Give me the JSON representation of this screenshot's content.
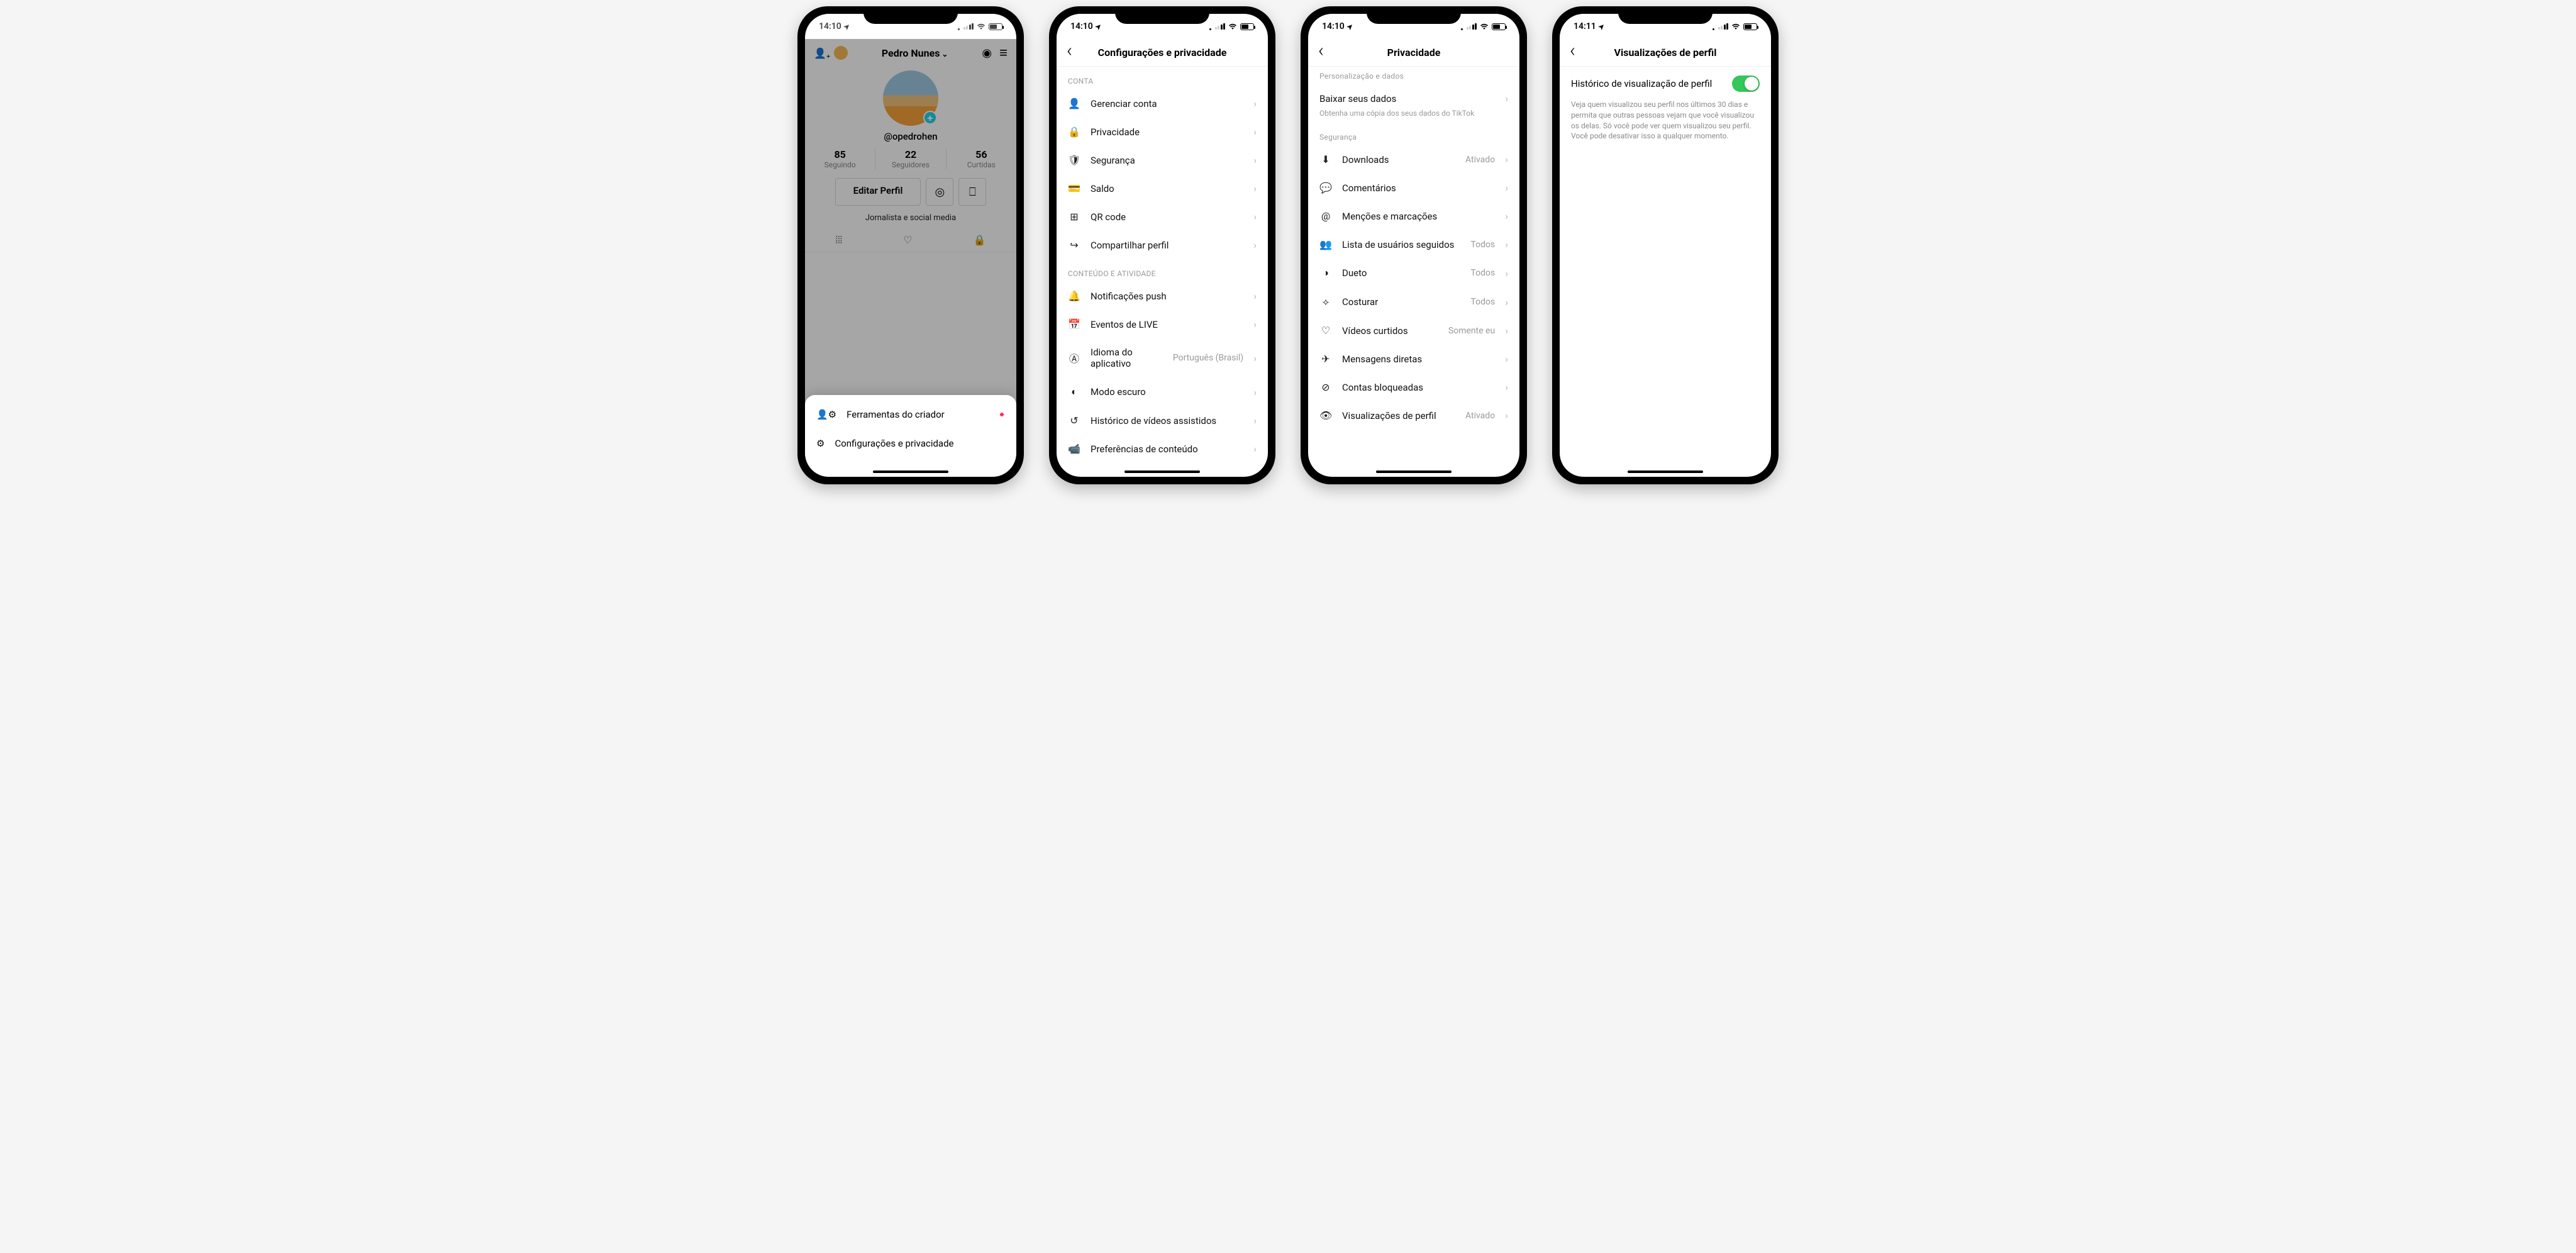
{
  "status": {
    "time1": "14:10",
    "time4": "14:11"
  },
  "screen1": {
    "name": "Pedro Nunes",
    "handle": "@opedrohen",
    "stats": [
      {
        "value": "85",
        "label": "Seguindo"
      },
      {
        "value": "22",
        "label": "Seguidores"
      },
      {
        "value": "56",
        "label": "Curtidas"
      }
    ],
    "edit_button": "Editar Perfil",
    "bio": "Jornalista e social media",
    "sheet": {
      "creator_tools": "Ferramentas do criador",
      "settings": "Configurações e privacidade"
    }
  },
  "screen2": {
    "title": "Configurações e privacidade",
    "section_conta": "CONTA",
    "items_conta": [
      {
        "icon": "👤",
        "label": "Gerenciar conta"
      },
      {
        "icon": "🔒",
        "label": "Privacidade"
      },
      {
        "icon": "🛡",
        "label": "Segurança"
      },
      {
        "icon": "💳",
        "label": "Saldo"
      },
      {
        "icon": "⊞",
        "label": "QR code"
      },
      {
        "icon": "↪",
        "label": "Compartilhar perfil"
      }
    ],
    "section_conteudo": "CONTEÚDO E ATIVIDADE",
    "items_conteudo": [
      {
        "icon": "🔔",
        "label": "Notificações push"
      },
      {
        "icon": "📅",
        "label": "Eventos de LIVE"
      },
      {
        "icon": "Ⓐ",
        "label": "Idioma do aplicativo",
        "value": "Português (Brasil)"
      },
      {
        "icon": "◐",
        "label": "Modo escuro"
      },
      {
        "icon": "↺",
        "label": "Histórico de vídeos assistidos"
      },
      {
        "icon": "📹",
        "label": "Preferências de conteúdo"
      }
    ]
  },
  "screen3": {
    "title": "Privacidade",
    "section_person": "Personalização e dados",
    "download_title": "Baixar seus dados",
    "download_note": "Obtenha uma cópia dos seus dados do TikTok",
    "section_seg": "Segurança",
    "items": [
      {
        "icon": "⬇",
        "label": "Downloads",
        "value": "Ativado"
      },
      {
        "icon": "💬",
        "label": "Comentários"
      },
      {
        "icon": "@",
        "label": "Menções e marcações"
      },
      {
        "icon": "👥",
        "label": "Lista de usuários seguidos",
        "value": "Todos"
      },
      {
        "icon": "◑",
        "label": "Dueto",
        "value": "Todos"
      },
      {
        "icon": "⟡",
        "label": "Costurar",
        "value": "Todos"
      },
      {
        "icon": "♡",
        "label": "Vídeos curtidos",
        "value": "Somente eu"
      },
      {
        "icon": "✈",
        "label": "Mensagens diretas"
      },
      {
        "icon": "⊘",
        "label": "Contas bloqueadas"
      },
      {
        "icon": "👁",
        "label": "Visualizações de perfil",
        "value": "Ativado"
      }
    ]
  },
  "screen4": {
    "title": "Visualizações de perfil",
    "toggle_label": "Histórico de visualização de perfil",
    "description": "Veja quem visualizou seu perfil nos últimos 30 dias e permita que outras pessoas vejam que você visualizou os delas. Só você pode ver quem visualizou seu perfil. Você pode desativar isso a qualquer momento."
  }
}
